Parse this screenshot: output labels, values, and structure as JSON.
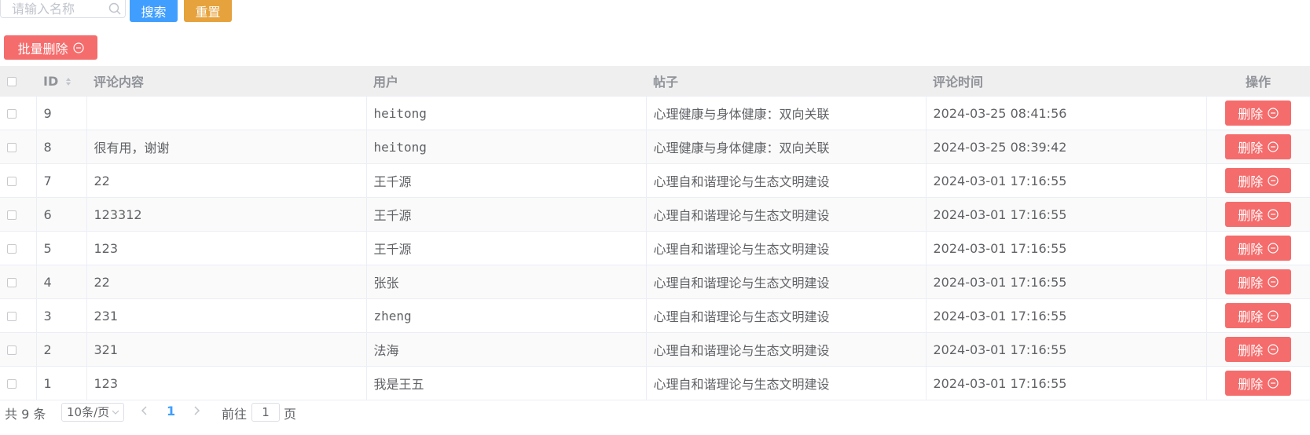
{
  "search": {
    "placeholder": "请输入名称"
  },
  "buttons": {
    "search": "搜索",
    "reset": "重置",
    "batch_delete": "批量删除"
  },
  "table": {
    "headers": {
      "id": "ID",
      "content": "评论内容",
      "user": "用户",
      "post": "帖子",
      "time": "评论时间",
      "op": "操作"
    },
    "delete_label": "删除",
    "rows": [
      {
        "id": "9",
        "content": "",
        "user": "heitong",
        "post": "心理健康与身体健康：双向关联",
        "time": "2024-03-25 08:41:56"
      },
      {
        "id": "8",
        "content": "很有用，谢谢",
        "user": "heitong",
        "post": "心理健康与身体健康：双向关联",
        "time": "2024-03-25 08:39:42"
      },
      {
        "id": "7",
        "content": "22",
        "user": "王千源",
        "post": "心理自和谐理论与生态文明建设",
        "time": "2024-03-01 17:16:55"
      },
      {
        "id": "6",
        "content": "123312",
        "user": "王千源",
        "post": "心理自和谐理论与生态文明建设",
        "time": "2024-03-01 17:16:55"
      },
      {
        "id": "5",
        "content": "123",
        "user": "王千源",
        "post": "心理自和谐理论与生态文明建设",
        "time": "2024-03-01 17:16:55"
      },
      {
        "id": "4",
        "content": "22",
        "user": "张张",
        "post": "心理自和谐理论与生态文明建设",
        "time": "2024-03-01 17:16:55"
      },
      {
        "id": "3",
        "content": "231",
        "user": "zheng",
        "post": "心理自和谐理论与生态文明建设",
        "time": "2024-03-01 17:16:55"
      },
      {
        "id": "2",
        "content": "321",
        "user": "法海",
        "post": "心理自和谐理论与生态文明建设",
        "time": "2024-03-01 17:16:55"
      },
      {
        "id": "1",
        "content": "123",
        "user": "我是王五",
        "post": "心理自和谐理论与生态文明建设",
        "time": "2024-03-01 17:16:55"
      }
    ]
  },
  "pagination": {
    "total_text": "共 9 条",
    "page_size": "10条/页",
    "current_page": "1",
    "goto_label": "前往",
    "goto_value": "1",
    "page_label": "页"
  },
  "colors": {
    "primary": "#409eff",
    "warning": "#e6a23c",
    "danger": "#f56c6c"
  }
}
